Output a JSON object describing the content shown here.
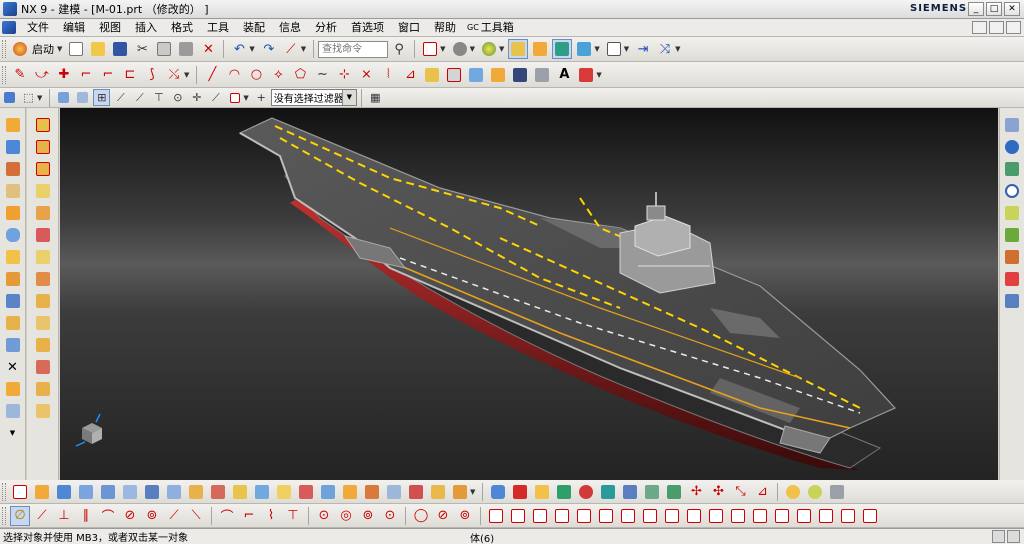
{
  "window": {
    "title": "NX 9 - 建模 - [M-01.prt （修改的） ]",
    "brand": "SIEMENS",
    "controls": [
      "_",
      "□",
      "✕"
    ]
  },
  "menu": {
    "items": [
      "文件",
      "编辑",
      "视图",
      "插入",
      "格式",
      "工具",
      "装配",
      "信息",
      "分析",
      "首选项",
      "窗口",
      "帮助"
    ],
    "gc_badge": "GC",
    "gc_label": "工具箱"
  },
  "toolbar_standard": {
    "start_label": "启动",
    "search_placeholder": "查找命令"
  },
  "selection_bar": {
    "filter_value": "没有选择过滤器"
  },
  "status": {
    "prompt": "选择对象并使用 MB3，或者双击某一对象",
    "selection_count": "体(6)"
  },
  "colors": {
    "viewport_dark": "#1b1b1b",
    "deck": "#4e4e4e",
    "deck_line_yellow": "#ffd400",
    "hull_red": "#8f1a1a",
    "statusbar": "#ecebe8"
  }
}
